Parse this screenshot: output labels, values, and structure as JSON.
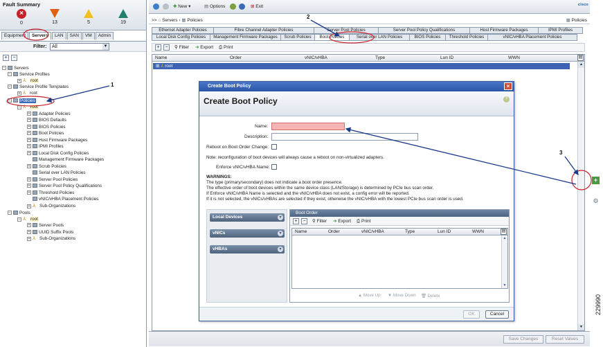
{
  "fault_summary": {
    "title": "Fault Summary",
    "counts": [
      {
        "level": "critical",
        "value": "0",
        "color": "#c8202a",
        "icon": "critical-x-icon"
      },
      {
        "level": "major",
        "value": "13",
        "color": "#e06010",
        "icon": "major-triangle-icon"
      },
      {
        "level": "minor",
        "value": "5",
        "color": "#f0c020",
        "icon": "minor-triangle-icon"
      },
      {
        "level": "warning",
        "value": "19",
        "color": "#20806a",
        "icon": "warning-triangle-icon"
      }
    ]
  },
  "nav_tabs": [
    "Equipment",
    "Servers",
    "LAN",
    "SAN",
    "VM",
    "Admin"
  ],
  "nav_active": "Servers",
  "filter": {
    "label": "Filter:",
    "value": "All"
  },
  "tree": [
    {
      "label": "Servers",
      "level": 0
    },
    {
      "label": "Service Profiles",
      "level": 1
    },
    {
      "label": "root",
      "level": 2
    },
    {
      "label": "Service Profile Templates",
      "level": 1
    },
    {
      "label": "root",
      "level": 2
    },
    {
      "label": "Policies",
      "level": 1
    },
    {
      "label": "root",
      "level": 2
    },
    {
      "label": "Adapter Policies",
      "level": 3
    },
    {
      "label": "BIOS Defaults",
      "level": 3
    },
    {
      "label": "BIOS Policies",
      "level": 3
    },
    {
      "label": "Boot Policies",
      "level": 3
    },
    {
      "label": "Host Firmware Packages",
      "level": 3
    },
    {
      "label": "IPMI Profiles",
      "level": 3
    },
    {
      "label": "Local Disk Config Policies",
      "level": 3
    },
    {
      "label": "Management Firmware Packages",
      "level": 3
    },
    {
      "label": "Scrub Policies",
      "level": 3
    },
    {
      "label": "Serial over LAN Policies",
      "level": 3
    },
    {
      "label": "Server Pool Policies",
      "level": 3
    },
    {
      "label": "Server Pool Policy Qualifications",
      "level": 3
    },
    {
      "label": "Threshold Policies",
      "level": 3
    },
    {
      "label": "vNIC/vHBA Placement Policies",
      "level": 3
    },
    {
      "label": "Sub-Organizations",
      "level": 3
    },
    {
      "label": "Pools",
      "level": 1
    },
    {
      "label": "root",
      "level": 2
    },
    {
      "label": "Server Pools",
      "level": 3
    },
    {
      "label": "UUID Suffix Pools",
      "level": 3
    },
    {
      "label": "Sub-Organizations",
      "level": 3
    }
  ],
  "toolbar": {
    "new": "New",
    "options": "Options",
    "exit": "Exit"
  },
  "brand": "cisco",
  "breadcrumb": {
    "prefix": ">>",
    "servers": "Servers",
    "sep": "›",
    "policies": "Policies",
    "right": "Policies"
  },
  "tabs_row1": [
    "Ethernet Adapter Policies",
    "Fibre Channel Adapter Policies",
    "Server Pool Policies",
    "Server Pool Policy Qualifications",
    "Host Firmware Packages",
    "IPMI Profiles"
  ],
  "tabs_row2": [
    "Local Disk Config Policies",
    "Management Firmware Packages",
    "Scrub Policies",
    "Boot Policies",
    "Serial over LAN Policies",
    "BIOS Policies",
    "Threshold Policies",
    "vNIC/vHBA Placement Policies"
  ],
  "tabs_active": "Boot Policies",
  "content_toolbar": {
    "filter": "Filter",
    "export": "Export",
    "print": "Print"
  },
  "grid": {
    "columns": [
      "Name",
      "Order",
      "vNIC/vHBA",
      "Type",
      "Lun ID",
      "WWN"
    ],
    "rows": [
      "root"
    ]
  },
  "bottom_buttons": {
    "save": "Save Changes",
    "reset": "Reset Values"
  },
  "dialog": {
    "title": "Create Boot Policy",
    "header": "Create Boot Policy",
    "name_label": "Name:",
    "description_label": "Description:",
    "reboot_label": "Reboot on Boot Order Change:",
    "note": "Note: reconfiguration of boot devices will always cause a reboot on non-virtualized adapters.",
    "enforce_label": "Enforce vNIC/vHBA Name:",
    "warnings_title": "WARNINGS:",
    "warnings": [
      "The type (primary/secondary) does not indicate a boot order presence.",
      "The effective order of boot devices within the same device class (LAN/Storage) is determined by PCIe bus scan order.",
      "If Enforce vNIC/vHBA Name is selected and the vNIC/vHBA does not exist, a config error will be reported.",
      "If it is not selected, the vNICs/vHBAs are selected if they exist, otherwise the vNIC/vHBA with the lowest PCIe bus scan order is used."
    ],
    "devices": [
      "Local Devices",
      "vNICs",
      "vHBAs"
    ],
    "boot_order": {
      "title": "Boot Order",
      "filter": "Filter",
      "export": "Export",
      "print": "Print",
      "columns": [
        "Name",
        "Order",
        "vNIC/vHBA",
        "Type",
        "Lun ID",
        "WWN"
      ],
      "move_up": "Move Up",
      "move_down": "Move Down",
      "delete": "Delete"
    },
    "ok": "OK",
    "cancel": "Cancel"
  },
  "annotations": [
    "1",
    "2",
    "3"
  ],
  "figure_id": "229990"
}
